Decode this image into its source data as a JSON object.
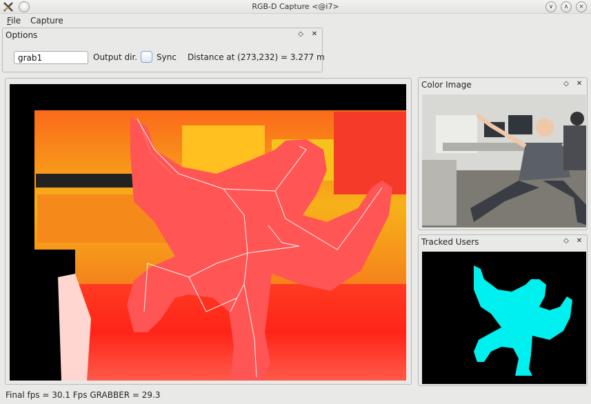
{
  "window": {
    "title": "RGB-D Capture <@i7>",
    "buttons": {
      "minimize": "∨",
      "maximize": "∧",
      "close": "×"
    }
  },
  "menu": {
    "file": {
      "mnemonic": "F",
      "rest": "ile"
    },
    "capture": "Capture"
  },
  "options_panel": {
    "title": "Options",
    "output_dir_value": "grab1",
    "output_dir_label": "Output dir.",
    "sync_label": "Sync",
    "sync_checked": false,
    "distance_text": "Distance at (273,232) = 3.277 m"
  },
  "color_panel": {
    "title": "Color Image"
  },
  "tracked_panel": {
    "title": "Tracked Users",
    "user_color": "#00f0f0"
  },
  "status": {
    "text": "Final fps = 30.1 Fps GRABBER = 29.3"
  },
  "icons": {
    "app": "app-x-icon",
    "menu": "window-menu-icon",
    "float": "float-icon",
    "close": "close-icon"
  },
  "colors": {
    "depth_near": "#ff5050",
    "depth_far": "#f6c21a",
    "depth_floor": "#ff2a18",
    "accent": "#7aa4cf"
  }
}
